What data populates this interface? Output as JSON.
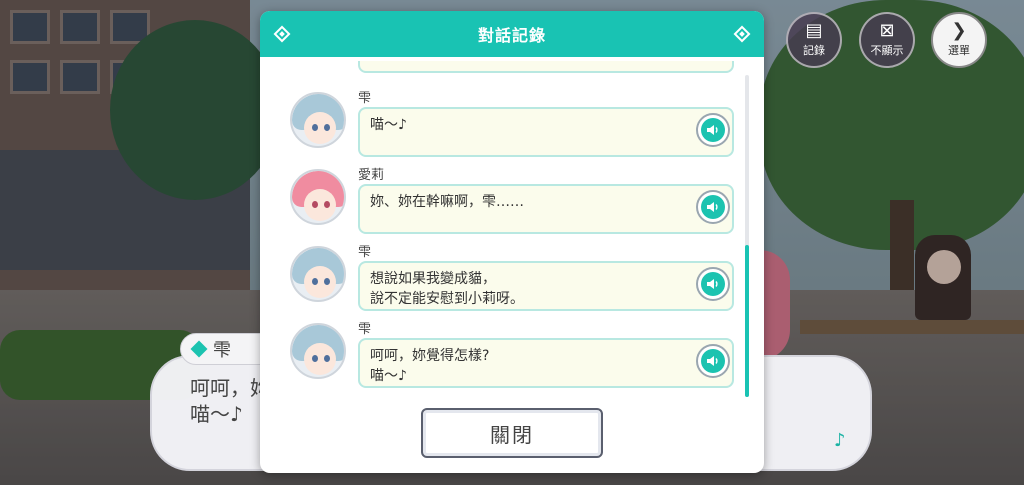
{
  "modal": {
    "title": "對話記錄",
    "close_label": "關閉",
    "entries": [
      {
        "speaker": "雫",
        "lines": [
          "喵～♪"
        ],
        "avatar": "shizuku"
      },
      {
        "speaker": "愛莉",
        "lines": [
          "妳、妳在幹嘛啊，雫……"
        ],
        "avatar": "airi"
      },
      {
        "speaker": "雫",
        "lines": [
          "想說如果我變成貓，",
          "說不定能安慰到小莉呀。"
        ],
        "avatar": "shizuku"
      },
      {
        "speaker": "雫",
        "lines": [
          "呵呵，妳覺得怎樣?",
          "喵～♪"
        ],
        "avatar": "shizuku"
      }
    ]
  },
  "hud": {
    "log_label": "記錄",
    "hide_label": "不顯示",
    "menu_label": "選單"
  },
  "dialog": {
    "speaker": "雫",
    "lines": [
      "呵呵，妳",
      "喵～♪"
    ]
  },
  "icons": {
    "voice": "speaker-icon",
    "log": "log-icon",
    "hide": "hide-icon",
    "menu": "chevron-right-icon",
    "note": "music-note-icon"
  },
  "colors": {
    "accent": "#19c3b3",
    "bubble_bg": "#fbfcec",
    "bubble_border": "#b8e8e1"
  }
}
